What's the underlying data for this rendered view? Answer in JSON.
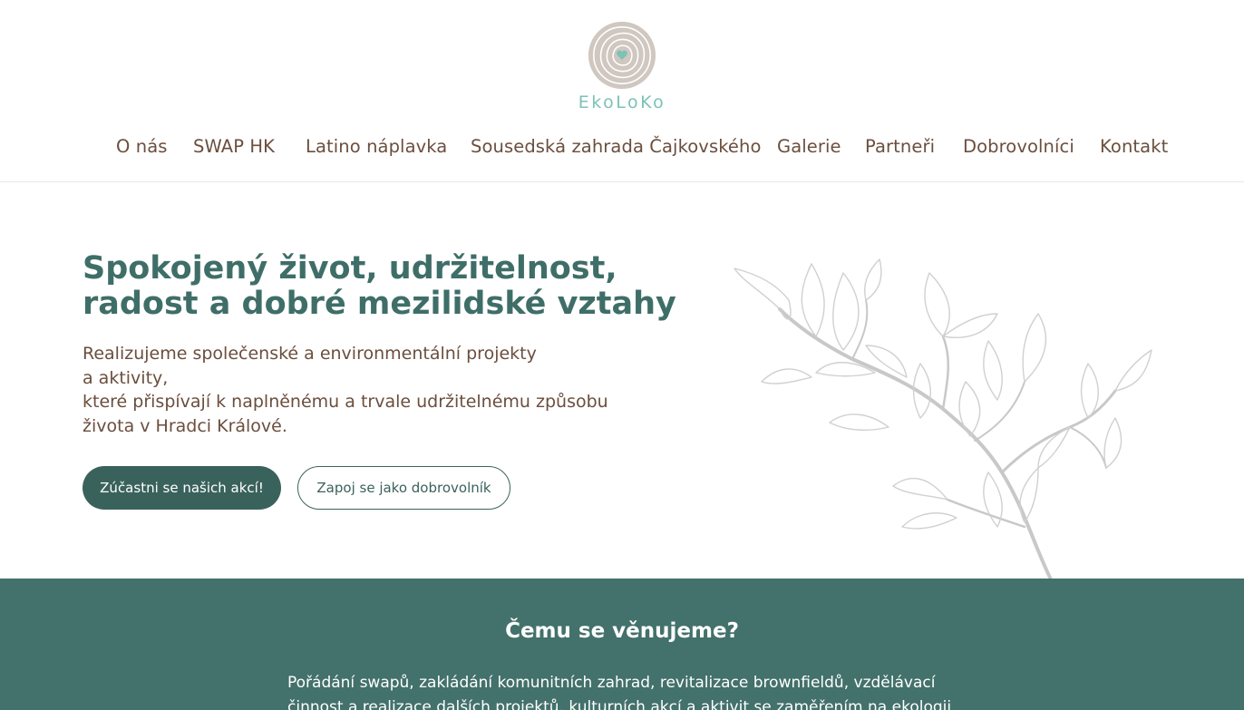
{
  "brand": {
    "name": "EkoLoKo",
    "accent": "#7dc2b6",
    "primary": "#3f6e68",
    "text": "#6b4e3d"
  },
  "nav": {
    "items": [
      {
        "label": "O nás"
      },
      {
        "label": "SWAP HK"
      },
      {
        "label": "Latino náplavka"
      },
      {
        "label": "Sousedská zahrada Čajkovského"
      },
      {
        "label": "Galerie"
      },
      {
        "label": "Partneři"
      },
      {
        "label": "Dobrovolníci"
      },
      {
        "label": "Kontakt"
      }
    ]
  },
  "hero": {
    "title_lines": [
      "Spokojený život, udržitelnost,",
      "radost a dobré mezilidské vztahy"
    ],
    "text_lines": [
      "Realizujeme společenské a environmentální projekty",
      "a aktivity,",
      "které přispívají k naplněnému a trvale udržitelnému způsobu",
      "života v Hradci Králové."
    ],
    "primary_button": "Zúčastni se našich akcí!",
    "secondary_button": "Zapoj se jako dobrovolník"
  },
  "section": {
    "title": "Čemu se věnujeme?",
    "text_lines": [
      "Pořádání swapů, zakládání komunitních zahrad, revitalizace brownfieldů, vzdělávací",
      "činnost a realizace dalších projektů, kulturních akcí a aktivit se zaměřením na ekologii"
    ]
  }
}
